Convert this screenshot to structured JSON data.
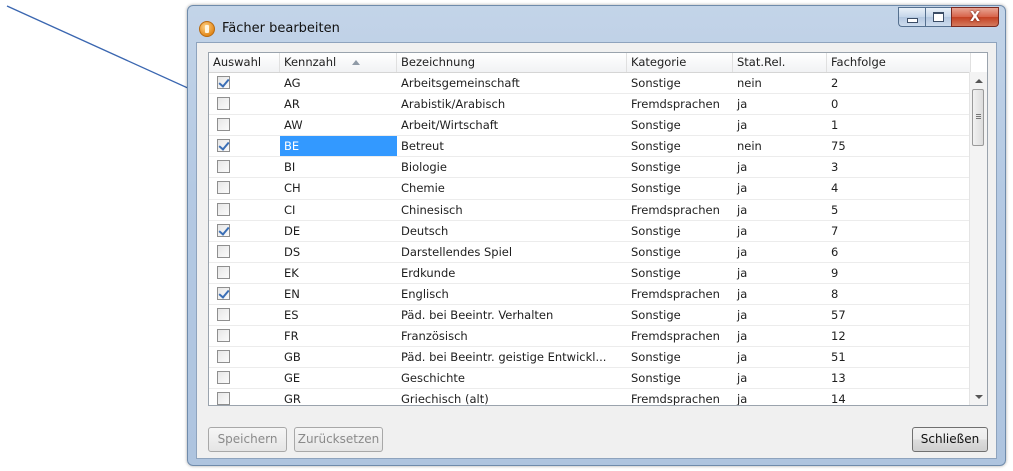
{
  "window": {
    "title": "Fächer bearbeiten",
    "controls": {
      "minimize": "minimize",
      "maximize": "maximize",
      "close": "X"
    }
  },
  "table": {
    "columns": [
      "Auswahl",
      "Kennzahl",
      "Bezeichnung",
      "Kategorie",
      "Stat.Rel.",
      "Fachfolge"
    ],
    "sorted_column": "Kennzahl",
    "sort_direction": "ascending",
    "rows": [
      {
        "checked": true,
        "code": "AG",
        "name": "Arbeitsgemeinschaft",
        "category": "Sonstige",
        "stat": "nein",
        "order": "2"
      },
      {
        "checked": false,
        "code": "AR",
        "name": "Arabistik/Arabisch",
        "category": "Fremdsprachen",
        "stat": "ja",
        "order": "0"
      },
      {
        "checked": false,
        "code": "AW",
        "name": "Arbeit/Wirtschaft",
        "category": "Sonstige",
        "stat": "ja",
        "order": "1"
      },
      {
        "checked": true,
        "code": "BE",
        "name": "Betreut",
        "category": "Sonstige",
        "stat": "nein",
        "order": "75"
      },
      {
        "checked": false,
        "code": "BI",
        "name": "Biologie",
        "category": "Sonstige",
        "stat": "ja",
        "order": "3"
      },
      {
        "checked": false,
        "code": "CH",
        "name": "Chemie",
        "category": "Sonstige",
        "stat": "ja",
        "order": "4"
      },
      {
        "checked": false,
        "code": "CI",
        "name": "Chinesisch",
        "category": "Fremdsprachen",
        "stat": "ja",
        "order": "5"
      },
      {
        "checked": true,
        "code": "DE",
        "name": "Deutsch",
        "category": "Sonstige",
        "stat": "ja",
        "order": "7"
      },
      {
        "checked": false,
        "code": "DS",
        "name": "Darstellendes Spiel",
        "category": "Sonstige",
        "stat": "ja",
        "order": "6"
      },
      {
        "checked": false,
        "code": "EK",
        "name": "Erdkunde",
        "category": "Sonstige",
        "stat": "ja",
        "order": "9"
      },
      {
        "checked": true,
        "code": "EN",
        "name": "Englisch",
        "category": "Fremdsprachen",
        "stat": "ja",
        "order": "8"
      },
      {
        "checked": false,
        "code": "ES",
        "name": "Päd. bei Beeintr. Verhalten",
        "category": "Sonstige",
        "stat": "ja",
        "order": "57"
      },
      {
        "checked": false,
        "code": "FR",
        "name": "Französisch",
        "category": "Fremdsprachen",
        "stat": "ja",
        "order": "12"
      },
      {
        "checked": false,
        "code": "GB",
        "name": "Päd. bei Beeintr. geistige Entwickl...",
        "category": "Sonstige",
        "stat": "ja",
        "order": "51"
      },
      {
        "checked": false,
        "code": "GE",
        "name": "Geschichte",
        "category": "Sonstige",
        "stat": "ja",
        "order": "13"
      },
      {
        "checked": false,
        "code": "GR",
        "name": "Griechisch (alt)",
        "category": "Fremdsprachen",
        "stat": "ja",
        "order": "14"
      }
    ],
    "selected_row_code": "BE"
  },
  "buttons": {
    "save": "Speichern",
    "reset": "Zurücksetzen",
    "close": "Schließen"
  },
  "colors": {
    "selection": "#3399ff",
    "pointer_line": "#3a66b0",
    "checkmark": "#3b6fb6"
  }
}
